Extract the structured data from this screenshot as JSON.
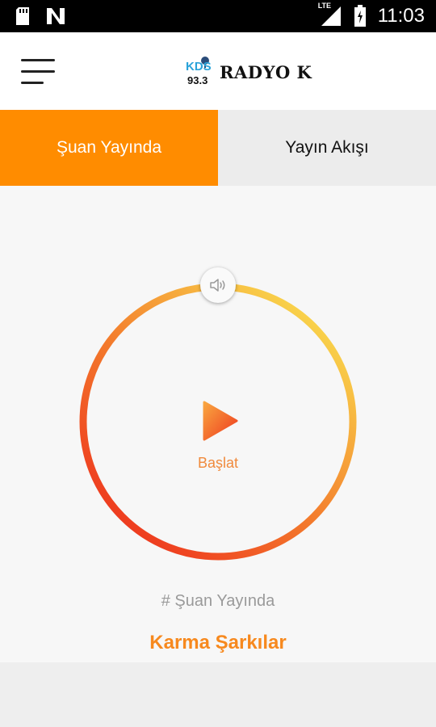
{
  "status_bar": {
    "time": "11:03",
    "network": "LTE",
    "icons": [
      "sd-card-icon",
      "n-notification-icon",
      "signal-icon",
      "battery-icon"
    ]
  },
  "app_bar": {
    "menu_icon": "hamburger-menu-icon",
    "logo": {
      "mark_text": "KDS",
      "frequency": "93.3",
      "station_name": "RADYO K"
    }
  },
  "tabs": [
    {
      "label": "Şuan Yayında",
      "active": true
    },
    {
      "label": "Yayın Akışı",
      "active": false
    }
  ],
  "player": {
    "start_label": "Başlat",
    "volume_icon": "volume-icon",
    "play_icon": "play-icon",
    "now_playing_label": "# Şuan Yayında",
    "program_name": "Karma Şarkılar"
  },
  "colors": {
    "accent": "#ff8c00",
    "ring_start": "#f9d44b",
    "ring_end": "#ee3a1f",
    "muted_text": "#9a9a9a"
  }
}
